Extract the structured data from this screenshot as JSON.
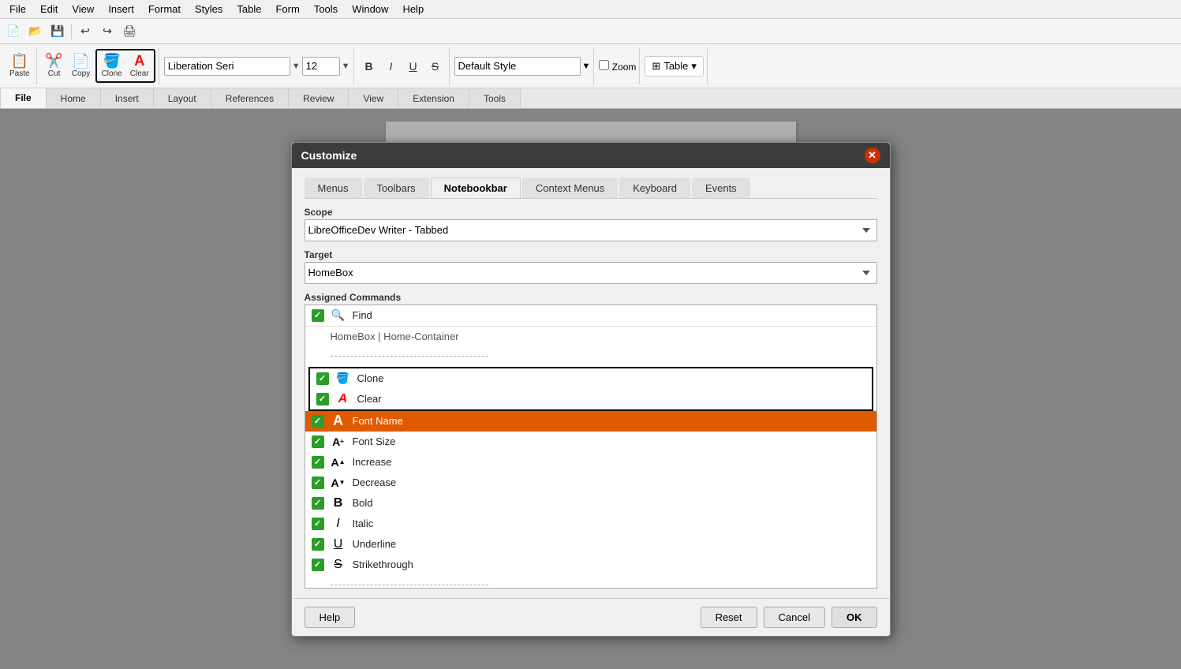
{
  "menubar": {
    "items": [
      "File",
      "Edit",
      "View",
      "Insert",
      "Format",
      "Styles",
      "Table",
      "Form",
      "Tools",
      "Window",
      "Help"
    ]
  },
  "toolbar_icons": {
    "items": [
      "new",
      "open",
      "save",
      "undo",
      "redo",
      "print"
    ]
  },
  "main_toolbar": {
    "paste_label": "Paste",
    "cut_label": "Cut",
    "copy_label": "Copy",
    "clone_label": "Clone",
    "clear_label": "Clear",
    "font_name": "Liberation Seri",
    "font_size": "12",
    "default_style": "Default Style",
    "zoom_label": "Zoom"
  },
  "nb_tabs": {
    "items": [
      "File",
      "Home",
      "Insert",
      "Layout",
      "References",
      "Review",
      "View",
      "Extension",
      "Tools"
    ]
  },
  "nb_table_btn": "Table",
  "dialog": {
    "title": "Customize",
    "tabs": [
      "Menus",
      "Toolbars",
      "Notebookbar",
      "Context Menus",
      "Keyboard",
      "Events"
    ],
    "active_tab": "Notebookbar",
    "scope_label": "Scope",
    "scope_value": "LibreOfficeDev Writer - Tabbed",
    "target_label": "Target",
    "target_value": "HomeBox",
    "assigned_commands_label": "Assigned Commands",
    "commands": [
      {
        "id": "find",
        "checked": true,
        "icon": "🔍",
        "label": "Find",
        "is_group": false
      },
      {
        "id": "homebox-container",
        "checked": false,
        "icon": "",
        "label": "HomeBox | Home-Container",
        "is_group": true
      },
      {
        "id": "sep1",
        "is_separator": true
      },
      {
        "id": "clone",
        "checked": true,
        "icon": "🪣",
        "label": "Clone",
        "is_group": false,
        "highlighted": true
      },
      {
        "id": "clear",
        "checked": true,
        "icon": "A",
        "label": "Clear",
        "is_group": false,
        "highlighted": true
      },
      {
        "id": "font-name",
        "checked": true,
        "icon": "A",
        "label": "Font Name",
        "is_group": false,
        "selected": true
      },
      {
        "id": "font-size",
        "checked": true,
        "icon": "A",
        "label": "Font Size",
        "is_group": false
      },
      {
        "id": "increase",
        "checked": true,
        "icon": "A",
        "label": "Increase",
        "is_group": false
      },
      {
        "id": "decrease",
        "checked": true,
        "icon": "A",
        "label": "Decrease",
        "is_group": false
      },
      {
        "id": "bold",
        "checked": true,
        "icon": "B",
        "label": "Bold",
        "is_group": false
      },
      {
        "id": "italic",
        "checked": true,
        "icon": "I",
        "label": "Italic",
        "is_group": false
      },
      {
        "id": "underline",
        "checked": true,
        "icon": "U",
        "label": "Underline",
        "is_group": false
      },
      {
        "id": "strikethrough",
        "checked": true,
        "icon": "S",
        "label": "Strikethrough",
        "is_group": false
      },
      {
        "id": "sep2",
        "is_separator": true
      }
    ],
    "footer": {
      "help_label": "Help",
      "reset_label": "Reset",
      "cancel_label": "Cancel",
      "ok_label": "OK"
    }
  }
}
